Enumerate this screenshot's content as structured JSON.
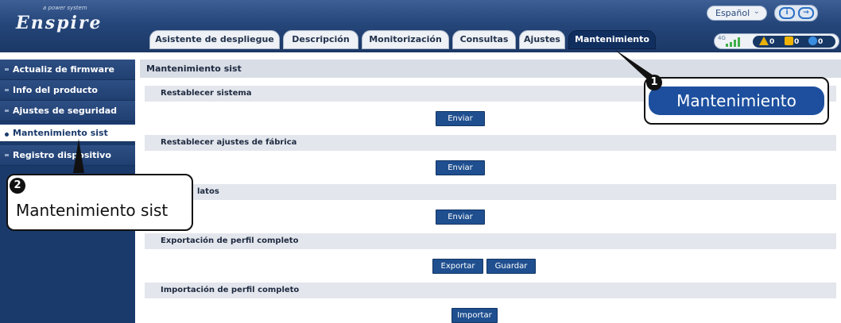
{
  "header": {
    "logo_tagline": "a power system",
    "logo_name": "Enspire",
    "language": "Español",
    "tabs": [
      {
        "label": "Asistente de despliegue"
      },
      {
        "label": "Descripción"
      },
      {
        "label": "Monitorización"
      },
      {
        "label": "Consultas"
      },
      {
        "label": "Ajustes"
      },
      {
        "label": "Mantenimiento",
        "active": true
      }
    ],
    "signal_label": "4G",
    "alarms": {
      "major": "0",
      "minor": "0",
      "warning": "0"
    }
  },
  "sidebar": {
    "items": [
      {
        "label": "Actualiz de firmware"
      },
      {
        "label": "Info del producto"
      },
      {
        "label": "Ajustes de seguridad"
      },
      {
        "label": "Mantenimiento sist",
        "active": true
      },
      {
        "label": "Registro dispositivo"
      }
    ]
  },
  "main": {
    "title": "Mantenimiento sist",
    "sections": [
      {
        "label": "Restablecer sistema",
        "buttons": [
          "Enviar"
        ]
      },
      {
        "label": "Restablecer ajustes de fábrica",
        "buttons": [
          "Enviar"
        ]
      },
      {
        "label": "latos",
        "buttons": [
          "Enviar"
        ]
      },
      {
        "label": "Exportación de perfil completo",
        "buttons": [
          "Exportar",
          "Guardar"
        ]
      },
      {
        "label": "Importación de perfil completo",
        "buttons": [
          "Importar"
        ]
      }
    ]
  },
  "callouts": [
    {
      "number": "1",
      "text": "Mantenimiento"
    },
    {
      "number": "2",
      "text": "Mantenimiento sist"
    }
  ],
  "colors": {
    "header": "#25467a",
    "sidebar": "#1b3a6c",
    "button": "#1f4f8f",
    "active_tab": "#102f5f",
    "callout": "#2a6dc9"
  }
}
